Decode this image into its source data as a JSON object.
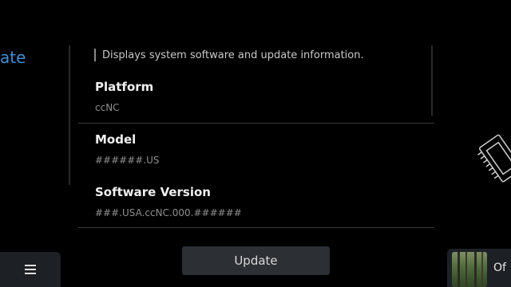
{
  "left_panel": {
    "heading": "ate"
  },
  "info": {
    "description": "Displays system software and update information.",
    "platform": {
      "label": "Platform",
      "value": "ccNC"
    },
    "model": {
      "label": "Model",
      "value": "######.US"
    },
    "software_version": {
      "label": "Software Version",
      "value": "###.USA.ccNC.000.######"
    }
  },
  "update_button": {
    "label": "Update"
  },
  "media": {
    "title": "Of"
  },
  "icons": {
    "menu": "menu-icon",
    "chip": "chip-icon"
  },
  "colors": {
    "background": "#000000",
    "accent": "#3d8ed6",
    "button": "#2c2f33"
  }
}
